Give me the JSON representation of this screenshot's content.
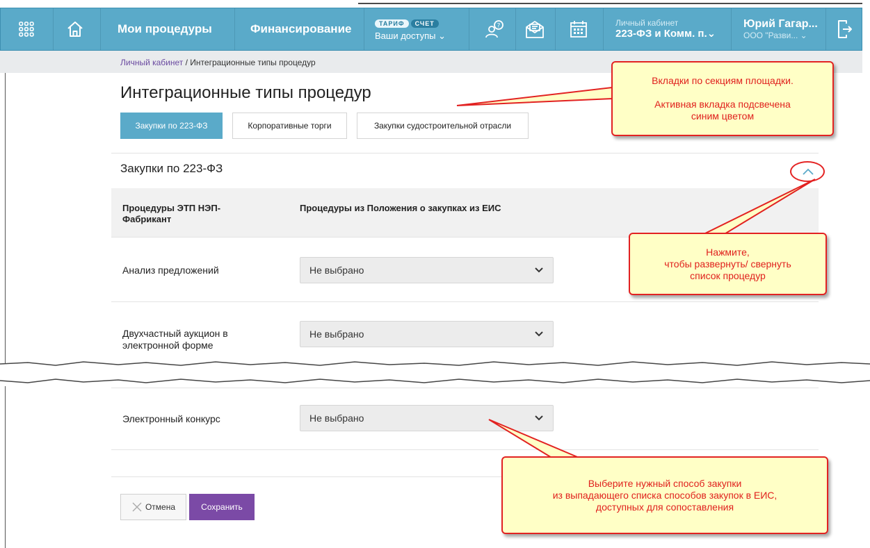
{
  "topbar": {
    "menu_procedures": "Мои процедуры",
    "menu_finance": "Финансирование",
    "pill_tariff": "ТАРИФ",
    "pill_invoice": "СЧЕТ",
    "access_label": "Ваши доступы ⌄",
    "cabinet_small": "Личный кабинет",
    "cabinet_main": "223-ФЗ и Комм. п.⌄",
    "user_name": "Юрий Гагар...",
    "user_org": "ООО \"Разви... ⌄",
    "bg_color": "#5aaac9"
  },
  "breadcrumb": {
    "link": "Личный кабинет",
    "separator": " / ",
    "current": "Интеграционные типы процедур"
  },
  "page_title": "Интеграционные типы процедур",
  "tabs": [
    {
      "label": "Закупки по 223-ФЗ",
      "active": true
    },
    {
      "label": "Корпоративные торги",
      "active": false
    },
    {
      "label": "Закупки судостроительной отрасли",
      "active": false
    }
  ],
  "section": {
    "title": "Закупки по 223-ФЗ",
    "col1_header": "Процедуры ЭТП НЭП-Фабрикант",
    "col2_header": "Процедуры из Положения о закупках из ЕИС"
  },
  "rows": [
    {
      "label": "Анализ предложений",
      "select_value": "Не выбрано"
    },
    {
      "label": "Двухчастный аукцион в электронной форме",
      "select_value": "Не выбрано"
    },
    {
      "label": "Электронный конкурс",
      "select_value": "Не выбрано"
    }
  ],
  "buttons": {
    "cancel": "Отмена",
    "save": "Сохранить",
    "save_color": "#7b4aa6"
  },
  "callouts": {
    "tabs_line1": "Вкладки по секциям площадки.",
    "tabs_line2": "Активная вкладка подсвечена",
    "tabs_line3": "синим цветом",
    "collapse_line1": "Нажмите,",
    "collapse_line2": "чтобы развернуть/ свернуть",
    "collapse_line3": "список процедур",
    "select_line1": "Выберите нужный способ закупки",
    "select_line2": "из выпадающего списка способов закупок в ЕИС,",
    "select_line3": "доступных для сопоставления",
    "border_color": "#e22222",
    "fill_color": "#ffffc6"
  },
  "icons": [
    "apps-grid-icon",
    "home-icon",
    "support-icon",
    "messages-icon",
    "calendar-icon",
    "logout-icon",
    "chevron-up-icon",
    "chevron-down-icon",
    "close-icon"
  ]
}
